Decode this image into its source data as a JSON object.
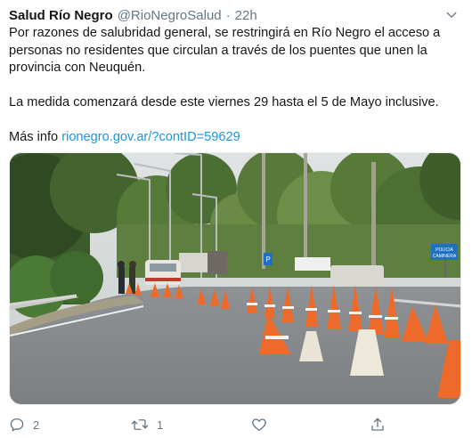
{
  "tweet": {
    "author_name": "Salud Río Negro",
    "handle": "@RioNegroSalud",
    "separator": "·",
    "time": "22h",
    "paragraph1": "Por razones de salubridad general, se restringirá en Río Negro el acceso a personas no residentes que circulan a través de los puentes que unen la provincia con Neuquén.",
    "paragraph2": "La medida comenzará desde este viernes 29 hasta el 5 de Mayo inclusive.",
    "more_info_label": "Más info",
    "more_info_link": "rionegro.gov.ar/?contID=59629",
    "media_sign_line1": "POLICIA",
    "media_sign_line2": "CAMINERA",
    "media_sign_p": "P"
  },
  "actions": {
    "reply_count": "2",
    "retweet_count": "1",
    "like_count": "",
    "share_count": ""
  },
  "icons": {
    "caret": "chevron-down-icon",
    "reply": "reply-icon",
    "retweet": "retweet-icon",
    "like": "heart-icon",
    "share": "share-icon"
  },
  "colors": {
    "text": "#14171a",
    "muted": "#657786",
    "link": "#1b95e0",
    "border": "#e6ecf0"
  }
}
